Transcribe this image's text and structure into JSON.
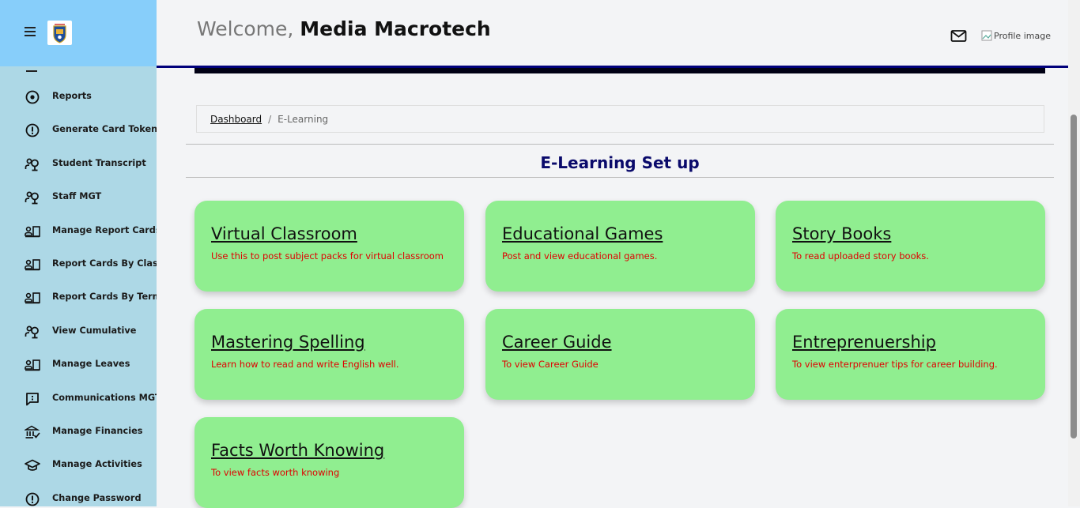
{
  "header": {
    "welcome_prefix": "Welcome,",
    "user_name": "Media Macrotech",
    "profile_alt": "Profile image"
  },
  "sidebar": {
    "items": [
      {
        "label": "Reports",
        "icon": "target-icon"
      },
      {
        "label": "Generate Card Token",
        "icon": "info-icon"
      },
      {
        "label": "Student Transcript",
        "icon": "person-search-icon"
      },
      {
        "label": "Staff MGT",
        "icon": "person-search-icon"
      },
      {
        "label": "Manage Report Cards",
        "icon": "id-card-icon"
      },
      {
        "label": "Report Cards By Class",
        "icon": "id-card-icon"
      },
      {
        "label": "Report Cards By Term",
        "icon": "id-card-icon"
      },
      {
        "label": "View Cumulative",
        "icon": "person-search-icon"
      },
      {
        "label": "Manage Leaves",
        "icon": "id-card-icon"
      },
      {
        "label": "Communications MGT",
        "icon": "chat-icon"
      },
      {
        "label": "Manage Financies",
        "icon": "bank-icon"
      },
      {
        "label": "Manage Activities",
        "icon": "graduation-cap-icon"
      },
      {
        "label": "Change Password",
        "icon": "info-icon"
      }
    ]
  },
  "breadcrumb": {
    "home": "Dashboard",
    "separator": "/",
    "current": "E-Learning"
  },
  "page_title": "E-Learning Set up",
  "cards": [
    {
      "title": "Virtual Classroom",
      "desc": "Use this to post subject packs for virtual classroom"
    },
    {
      "title": "Educational Games",
      "desc": "Post and view educational games."
    },
    {
      "title": "Story Books",
      "desc": "To read uploaded story books."
    },
    {
      "title": "Mastering Spelling",
      "desc": "Learn how to read and write English well."
    },
    {
      "title": "Career Guide",
      "desc": "To view Career Guide"
    },
    {
      "title": "Entreprenuership",
      "desc": "To view enterprenuer tips for career building."
    },
    {
      "title": "Facts Worth Knowing",
      "desc": "To view facts worth knowing"
    }
  ],
  "colors": {
    "sidebar_bg": "#add8e6",
    "sidebar_header_bg": "#87cefa",
    "card_bg": "#90ee90",
    "card_desc": "#e00000",
    "title_color": "#0a0a6b"
  }
}
